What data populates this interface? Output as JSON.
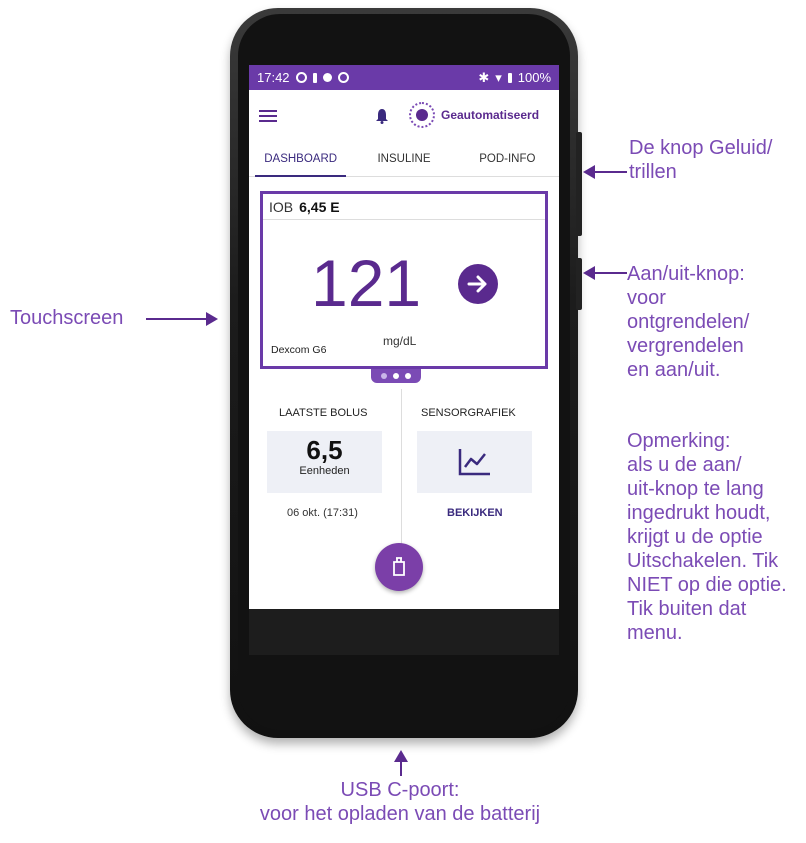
{
  "statusbar": {
    "time": "17:42",
    "battery": "100%"
  },
  "appbar": {
    "mode_label": "Geautomatiseerd"
  },
  "tabs": [
    {
      "label": "DASHBOARD",
      "active": true
    },
    {
      "label": "INSULINE",
      "active": false
    },
    {
      "label": "POD-INFO",
      "active": false
    }
  ],
  "glucose": {
    "iob_label": "IOB",
    "iob_value": "6,45 E",
    "value": "121",
    "unit": "mg/dL",
    "sensor": "Dexcom G6"
  },
  "bolus": {
    "title": "LAATSTE BOLUS",
    "value": "6,5",
    "unit": "Eenheden",
    "date": "06 okt. (17:31)"
  },
  "sensor_graph": {
    "title": "SENSORGRAFIEK",
    "link": "BEKIJKEN"
  },
  "callouts": {
    "sound": [
      "De knop Geluid/",
      "trillen"
    ],
    "power": [
      "Aan/uit-knop:",
      "voor",
      "ontgrendelen/",
      "vergrendelen",
      "en aan/uit."
    ],
    "note": [
      "Opmerking:",
      "als u de aan/",
      "uit-knop te lang",
      "ingedrukt houdt,",
      "krijgt u de optie",
      "Uitschakelen. Tik",
      "NIET op die optie.",
      "Tik buiten dat",
      "menu."
    ],
    "touchscreen": "Touchscreen",
    "usb": [
      "USB C-poort:",
      "voor het opladen van de batterij"
    ]
  },
  "colors": {
    "accent": "#6a3aa8",
    "text_purple": "#7b4bb5"
  }
}
